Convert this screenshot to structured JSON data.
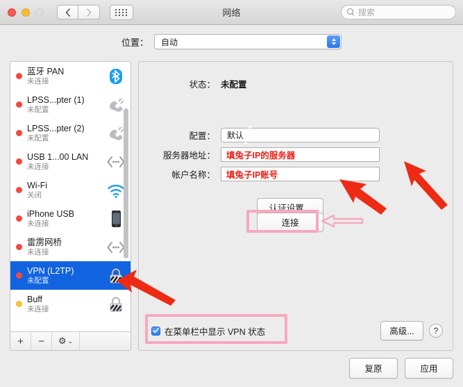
{
  "window": {
    "title": "网络",
    "traffic_lights": [
      "close",
      "minimize",
      "zoom"
    ],
    "back_icon": "chevron-left-icon",
    "forward_icon": "chevron-right-icon",
    "grid_icon": "grid-view-icon"
  },
  "search": {
    "placeholder": "搜索",
    "icon": "search-icon"
  },
  "location": {
    "label": "位置：",
    "value": "自动"
  },
  "sidebar": {
    "items": [
      {
        "name": "蓝牙 PAN",
        "status": "未连接",
        "dot": "red",
        "icon": "bluetooth-icon",
        "selected": false
      },
      {
        "name": "LPSS...pter (1)",
        "status": "未配置",
        "dot": "red",
        "icon": "modem-icon",
        "selected": false
      },
      {
        "name": "LPSS...pter (2)",
        "status": "未配置",
        "dot": "red",
        "icon": "modem-icon",
        "selected": false
      },
      {
        "name": "USB 1...00 LAN",
        "status": "未连接",
        "dot": "red",
        "icon": "ethernet-icon",
        "selected": false
      },
      {
        "name": "Wi-Fi",
        "status": "关闭",
        "dot": "red",
        "icon": "wifi-icon",
        "selected": false
      },
      {
        "name": "iPhone USB",
        "status": "未连接",
        "dot": "red",
        "icon": "iphone-icon",
        "selected": false
      },
      {
        "name": "雷雳网桥",
        "status": "未连接",
        "dot": "red",
        "icon": "ethernet-icon",
        "selected": false
      },
      {
        "name": "VPN (L2TP)",
        "status": "未配置",
        "dot": "red",
        "icon": "vpn-lock-icon",
        "selected": true
      },
      {
        "name": "Buff",
        "status": "未连接",
        "dot": "yellow",
        "icon": "vpn-lock-icon",
        "selected": false
      }
    ],
    "toolbar": {
      "add": "+",
      "remove": "−",
      "gear": "⚙",
      "gear_chevron": "⌄"
    }
  },
  "main": {
    "status_label": "状态：",
    "status_value": "未配置",
    "fields": [
      {
        "label": "配置：",
        "value": "默认",
        "type": "popup",
        "value_color": "#1c1c1c"
      },
      {
        "label": "服务器地址：",
        "value": "填兔子IP的服务器",
        "type": "text",
        "value_color": "#e8211a"
      },
      {
        "label": "帐户名称：",
        "value": "填兔子IP账号",
        "type": "text",
        "value_color": "#e8211a"
      }
    ],
    "auth_button": "认证设置...",
    "connect_button": "连接",
    "checkbox": {
      "label": "在菜单栏中显示 VPN 状态",
      "checked": true
    },
    "advanced_button": "高级...",
    "help_button": "?"
  },
  "footer": {
    "revert_button": "复原",
    "apply_button": "应用"
  },
  "annotations": {
    "accent_red": "#ee2a15",
    "accent_pink": "#f7a8c0",
    "arrow_vpn": "red-arrow-pointing-vpn-item",
    "arrow_server": "red-arrow-pointing-server-address",
    "arrow_account": "red-arrow-pointing-account-name",
    "arrow_auth": "pink-arrow-pointing-auth-settings"
  }
}
